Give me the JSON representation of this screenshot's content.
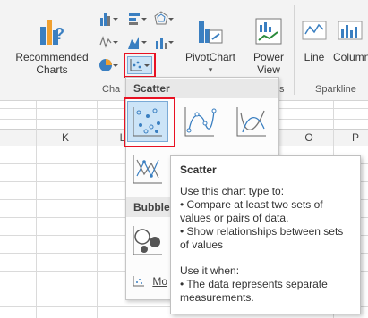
{
  "ribbon": {
    "recommended_charts": "Recommended\nCharts",
    "recommended_line1": "Recommended",
    "recommended_line2": "Charts",
    "pivotchart": "PivotChart",
    "power_view_line1": "Power",
    "power_view_line2": "View",
    "sparkline_line": "Line",
    "sparkline_column": "Column",
    "group_charts": "Cha",
    "group_charts_tail": "s",
    "group_sparklines": "Sparkline"
  },
  "columns": [
    "K",
    "L",
    "O",
    "P"
  ],
  "menu": {
    "scatter_header": "Scatter",
    "bubble_header": "Bubble",
    "more_link": "Mo"
  },
  "tooltip": {
    "title": "Scatter",
    "lines": [
      "Use this chart type to:",
      "• Compare at least two sets of",
      "values or pairs of data.",
      "• Show relationships between sets",
      "of values",
      "",
      "Use it when:",
      "• The data represents separate",
      "measurements."
    ]
  },
  "colors": {
    "highlight": "#e81123",
    "ribbon_bg": "#f3f3f3",
    "chart_accent": "#3a7fc1"
  }
}
